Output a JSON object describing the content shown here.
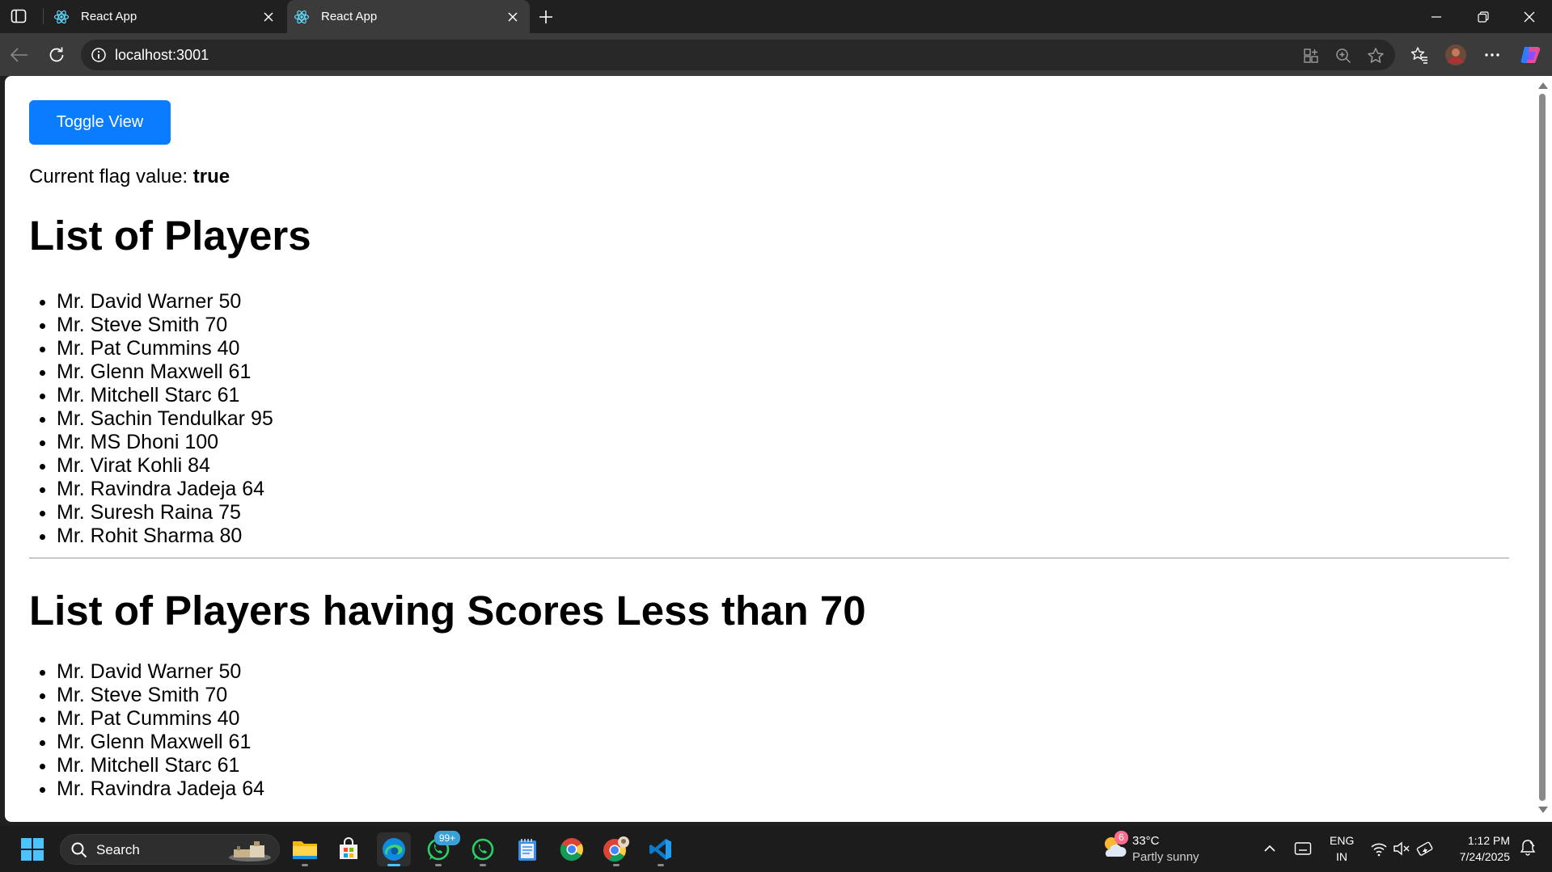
{
  "browser": {
    "tabs": [
      {
        "title": "React App",
        "active": false,
        "favicon": "react-logo-icon"
      },
      {
        "title": "React App",
        "active": true,
        "favicon": "react-logo-icon"
      }
    ],
    "address": "localhost:3001"
  },
  "page": {
    "toggle_label": "Toggle View",
    "flag_label": "Current flag value:",
    "flag_value": "true",
    "heading_all": "List of Players",
    "players_all": [
      "Mr. David Warner 50",
      "Mr. Steve Smith 70",
      "Mr. Pat Cummins 40",
      "Mr. Glenn Maxwell 61",
      "Mr. Mitchell Starc 61",
      "Mr. Sachin Tendulkar 95",
      "Mr. MS Dhoni 100",
      "Mr. Virat Kohli 84",
      "Mr. Ravindra Jadeja 64",
      "Mr. Suresh Raina 75",
      "Mr. Rohit Sharma 80"
    ],
    "heading_filtered": "List of Players having Scores Less than 70",
    "players_filtered": [
      "Mr. David Warner 50",
      "Mr. Steve Smith 70",
      "Mr. Pat Cummins 40",
      "Mr. Glenn Maxwell 61",
      "Mr. Mitchell Starc 61",
      "Mr. Ravindra Jadeja 64"
    ]
  },
  "taskbar": {
    "search_label": "Search",
    "whatsapp_badge": "99+",
    "weather_badge": "6",
    "weather_temp": "33°C",
    "weather_desc": "Partly sunny",
    "lang_top": "ENG",
    "lang_bottom": "IN",
    "time": "1:12 PM",
    "date": "7/24/2025"
  },
  "colors": {
    "accent_button": "#0a7cff",
    "edge_active": "#4cc2ff"
  }
}
